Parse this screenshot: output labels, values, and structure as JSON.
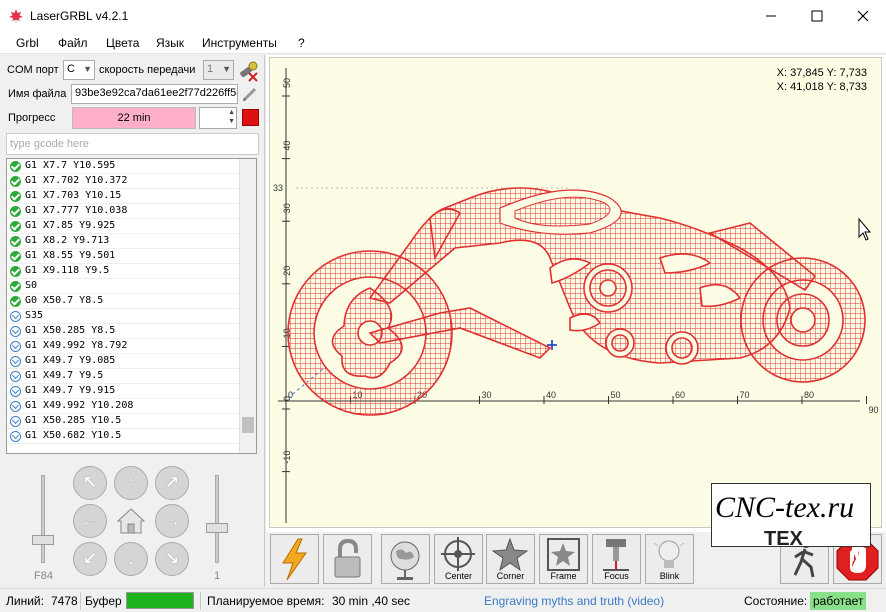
{
  "window": {
    "title": "LaserGRBL v4.2.1",
    "minimize_icon": "minimize-icon",
    "maximize_icon": "maximize-icon",
    "close_icon": "close-icon"
  },
  "menu": [
    "Grbl",
    "Файл",
    "Цвета",
    "Язык",
    "Инструменты",
    "?"
  ],
  "connection": {
    "com_label": "COM порт",
    "com_value": "C",
    "baud_label": "скорость передачи",
    "baud_value": "1",
    "file_label": "Имя файла",
    "file_value": "93be3e92ca7da61ee2f77d226ff58",
    "progress_label": "Прогресс",
    "progress_text": "22 min",
    "progress_fraction": 1.0,
    "progress_color": "#ffb0c8",
    "repeat_value": ""
  },
  "gcode": {
    "placeholder": "type gcode here",
    "lines": [
      {
        "text": "G1 X7.7 Y10.595",
        "status": "ok"
      },
      {
        "text": "G1 X7.702 Y10.372",
        "status": "ok"
      },
      {
        "text": "G1 X7.703 Y10.15",
        "status": "ok"
      },
      {
        "text": "G1 X7.777 Y10.038",
        "status": "ok"
      },
      {
        "text": "G1 X7.85 Y9.925",
        "status": "ok"
      },
      {
        "text": "G1 X8.2 Y9.713",
        "status": "ok"
      },
      {
        "text": "G1 X8.55 Y9.501",
        "status": "ok"
      },
      {
        "text": "G1 X9.118 Y9.5",
        "status": "ok"
      },
      {
        "text": "S0",
        "status": "ok"
      },
      {
        "text": "G0 X50.7 Y8.5",
        "status": "ok"
      },
      {
        "text": "S35",
        "status": "queued"
      },
      {
        "text": "G1 X50.285 Y8.5",
        "status": "queued"
      },
      {
        "text": "G1 X49.992 Y8.792",
        "status": "queued"
      },
      {
        "text": "G1 X49.7 Y9.085",
        "status": "queued"
      },
      {
        "text": "G1 X49.7 Y9.5",
        "status": "queued"
      },
      {
        "text": "G1 X49.7 Y9.915",
        "status": "queued"
      },
      {
        "text": "G1 X49.992 Y10.208",
        "status": "queued"
      },
      {
        "text": "G1 X50.285 Y10.5",
        "status": "queued"
      },
      {
        "text": "G1 X50.682 Y10.5",
        "status": "queued"
      }
    ]
  },
  "jog": {
    "feed_label": "F84",
    "step_label": "1",
    "icons": [
      "arrow-up-left-icon",
      "arrow-up-icon",
      "arrow-up-right-icon",
      "arrow-left-icon",
      "home-icon",
      "arrow-right-icon",
      "arrow-down-left-icon",
      "arrow-down-icon",
      "arrow-down-right-icon"
    ]
  },
  "preview": {
    "coord_line1": "X: 37,845 Y: 7,733",
    "coord_line2": "X: 41,018 Y: 8,733",
    "x_ticks": [
      "0",
      "10",
      "20",
      "30",
      "40",
      "50",
      "60",
      "70",
      "80",
      "90"
    ],
    "y_ticks": [
      "50",
      "40",
      "30",
      "20",
      "10",
      "0",
      "-10"
    ],
    "y_marker": "33",
    "design_color": "#e03030"
  },
  "toolbar": {
    "buttons": [
      {
        "name": "run-button",
        "icon": "lightning-icon",
        "label": ""
      },
      {
        "name": "unlock-button",
        "icon": "padlock-icon",
        "label": ""
      },
      {
        "name": "globe-button",
        "icon": "globe-icon",
        "label": ""
      },
      {
        "name": "center-button",
        "icon": "crosshair-wheel-icon",
        "label": "Center"
      },
      {
        "name": "corner-button",
        "icon": "star-corner-icon",
        "label": "Corner"
      },
      {
        "name": "frame-button",
        "icon": "frame-icon",
        "label": "Frame"
      },
      {
        "name": "focus-button",
        "icon": "focus-icon",
        "label": "Focus"
      },
      {
        "name": "blink-button",
        "icon": "bulb-icon",
        "label": "Blink"
      }
    ]
  },
  "watermark": {
    "line1": "CNC-tex.ru",
    "line2": "TEX"
  },
  "status": {
    "lines_label": "Линий:",
    "lines_value": "7478",
    "buffer_label": "Буфер",
    "buffer_fraction": 1.0,
    "buffer_color": "#1fb31f",
    "time_label": "Планируемое время:",
    "time_value": "30 min ,40 sec",
    "link": "Engraving myths and truth (video)",
    "state_label": "Состояние:",
    "state_value": "работает",
    "state_color": "#8ae08a"
  }
}
